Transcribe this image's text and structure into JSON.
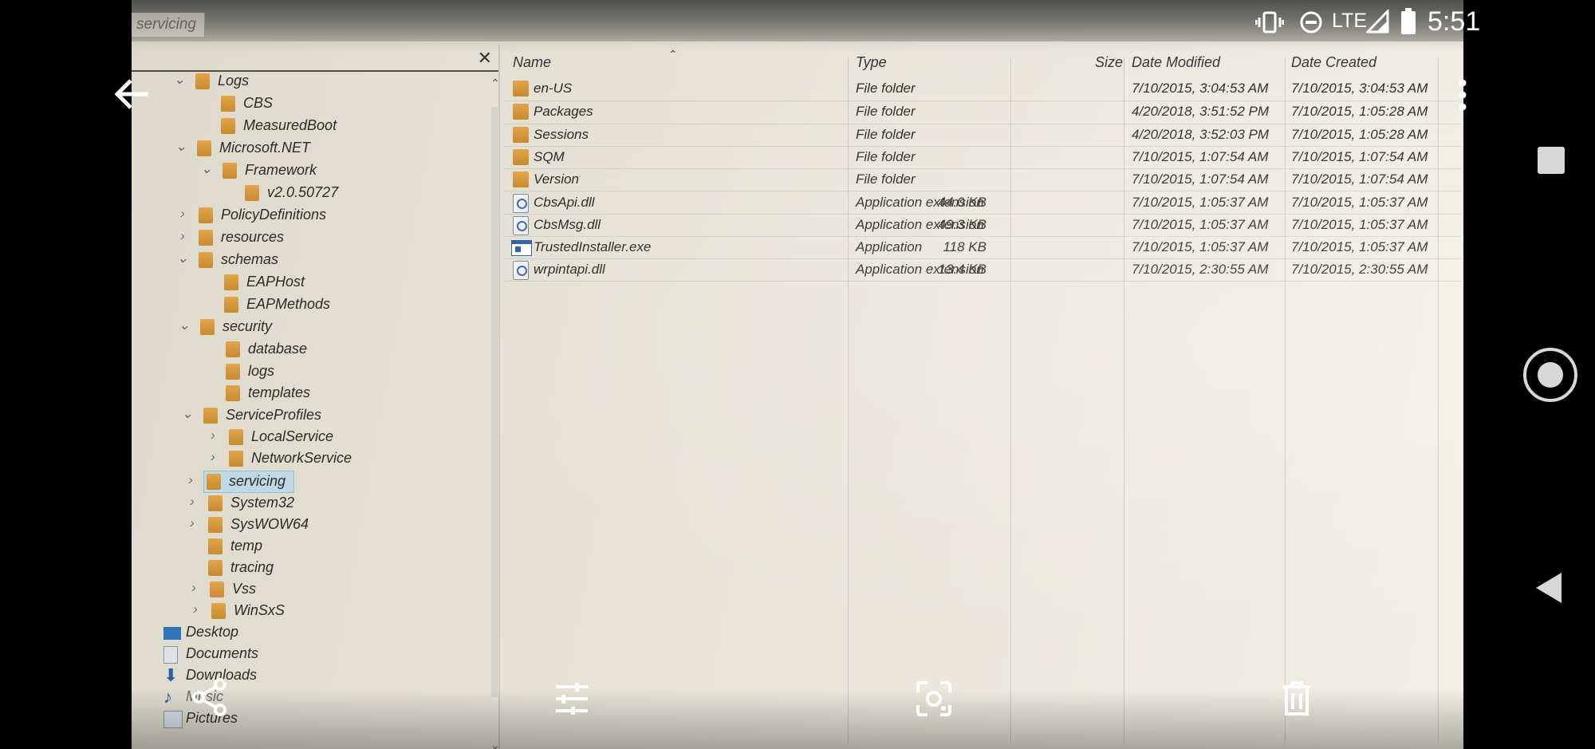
{
  "window": {
    "title_tab": "servicing"
  },
  "status_bar": {
    "time": "5:51",
    "network": "LTE"
  },
  "tree": {
    "nodes": [
      {
        "label": "Logs",
        "expanded": true
      },
      {
        "label": "CBS"
      },
      {
        "label": "MeasuredBoot"
      },
      {
        "label": "Microsoft.NET",
        "expanded": true
      },
      {
        "label": "Framework",
        "expanded": true
      },
      {
        "label": "v2.0.50727"
      },
      {
        "label": "PolicyDefinitions",
        "expanded": false
      },
      {
        "label": "resources",
        "expanded": false
      },
      {
        "label": "schemas",
        "expanded": true
      },
      {
        "label": "EAPHost"
      },
      {
        "label": "EAPMethods"
      },
      {
        "label": "security",
        "expanded": true
      },
      {
        "label": "database"
      },
      {
        "label": "logs"
      },
      {
        "label": "templates"
      },
      {
        "label": "ServiceProfiles",
        "expanded": true
      },
      {
        "label": "LocalService",
        "expanded": false
      },
      {
        "label": "NetworkService",
        "expanded": false
      },
      {
        "label": "servicing",
        "expanded": false,
        "selected": true
      },
      {
        "label": "System32",
        "expanded": false
      },
      {
        "label": "SysWOW64",
        "expanded": false
      },
      {
        "label": "temp"
      },
      {
        "label": "tracing"
      },
      {
        "label": "Vss",
        "expanded": false
      },
      {
        "label": "WinSxS",
        "expanded": false
      },
      {
        "label": "Desktop"
      },
      {
        "label": "Documents"
      },
      {
        "label": "Downloads"
      },
      {
        "label": "Music"
      },
      {
        "label": "Pictures"
      }
    ]
  },
  "list": {
    "columns": {
      "name": "Name",
      "type": "Type",
      "size": "Size",
      "modified": "Date Modified",
      "created": "Date Created"
    },
    "rows": [
      {
        "name": "en-US",
        "type": "File folder",
        "size": "",
        "modified": "7/10/2015, 3:04:53 AM",
        "created": "7/10/2015, 3:04:53 AM",
        "icon": "folder"
      },
      {
        "name": "Packages",
        "type": "File folder",
        "size": "",
        "modified": "4/20/2018, 3:51:52 PM",
        "created": "7/10/2015, 1:05:28 AM",
        "icon": "folder"
      },
      {
        "name": "Sessions",
        "type": "File folder",
        "size": "",
        "modified": "4/20/2018, 3:52:03 PM",
        "created": "7/10/2015, 1:05:28 AM",
        "icon": "folder"
      },
      {
        "name": "SQM",
        "type": "File folder",
        "size": "",
        "modified": "7/10/2015, 1:07:54 AM",
        "created": "7/10/2015, 1:07:54 AM",
        "icon": "folder"
      },
      {
        "name": "Version",
        "type": "File folder",
        "size": "",
        "modified": "7/10/2015, 1:07:54 AM",
        "created": "7/10/2015, 1:07:54 AM",
        "icon": "folder"
      },
      {
        "name": "CbsApi.dll",
        "type": "Application extension",
        "size": "44.0 KB",
        "modified": "7/10/2015, 1:05:37 AM",
        "created": "7/10/2015, 1:05:37 AM",
        "icon": "dll"
      },
      {
        "name": "CbsMsg.dll",
        "type": "Application extension",
        "size": "49.3 KB",
        "modified": "7/10/2015, 1:05:37 AM",
        "created": "7/10/2015, 1:05:37 AM",
        "icon": "dll"
      },
      {
        "name": "TrustedInstaller.exe",
        "type": "Application",
        "size": "118 KB",
        "modified": "7/10/2015, 1:05:37 AM",
        "created": "7/10/2015, 1:05:37 AM",
        "icon": "exe"
      },
      {
        "name": "wrpintapi.dll",
        "type": "Application extension",
        "size": "13.4 KB",
        "modified": "7/10/2015, 2:30:55 AM",
        "created": "7/10/2015, 2:30:55 AM",
        "icon": "dll"
      }
    ]
  },
  "overlay": {
    "back": "back-arrow-icon",
    "more": "more-vert-icon",
    "share": "share-icon",
    "edit": "tune-icon",
    "lens": "lens-icon",
    "delete": "trash-icon"
  },
  "nav": {
    "recents": "square-icon",
    "home": "home-circle-icon",
    "back": "triangle-back-icon"
  }
}
